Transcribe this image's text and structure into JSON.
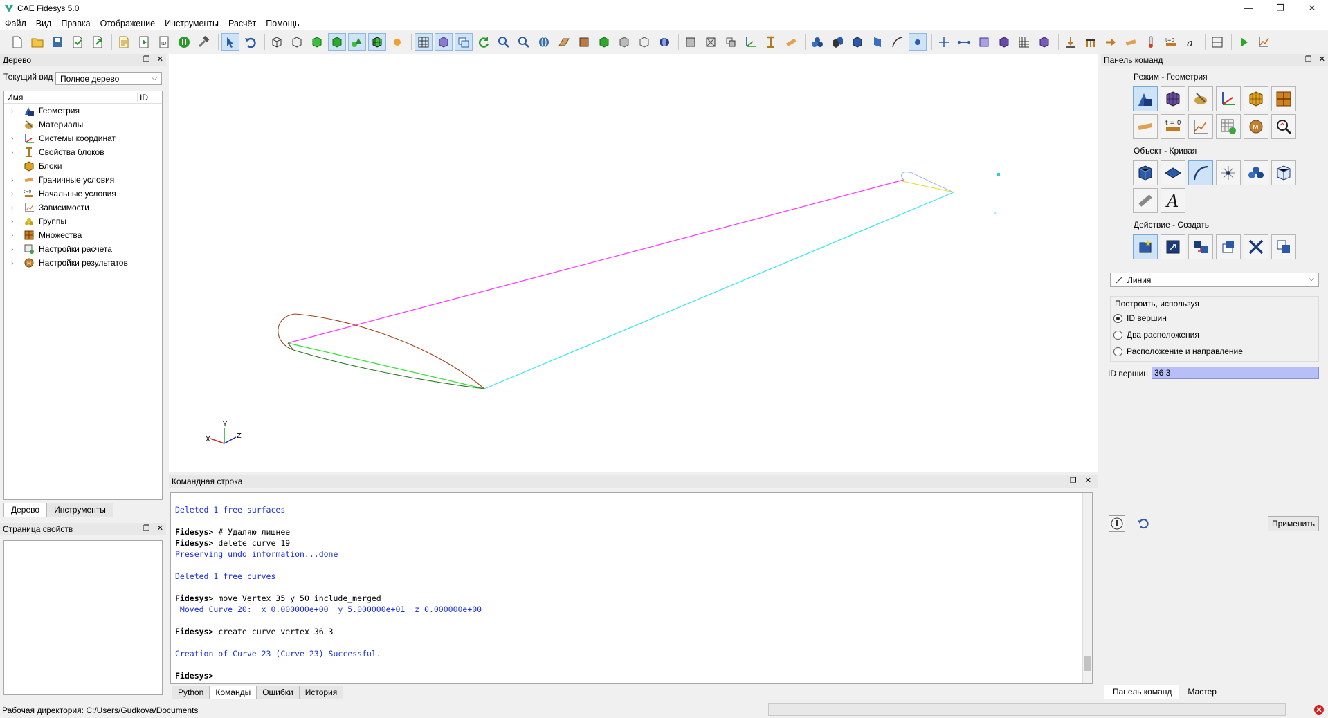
{
  "window": {
    "title": "CAE Fidesys 5.0",
    "controls": [
      "—",
      "❐",
      "✕"
    ]
  },
  "menu": [
    "Файл",
    "Вид",
    "Правка",
    "Отображение",
    "Инструменты",
    "Расчёт",
    "Помощь"
  ],
  "tree_dock": {
    "title": "Дерево",
    "view_label": "Текущий вид",
    "view_value": "Полное дерево",
    "col_name": "Имя",
    "col_id": "ID",
    "items": [
      {
        "label": "Геометрия",
        "icon": "geometry-icon"
      },
      {
        "label": "Материалы",
        "icon": "materials-icon"
      },
      {
        "label": "Системы координат",
        "icon": "coordinate-systems-icon"
      },
      {
        "label": "Свойства блоков",
        "icon": "block-properties-icon"
      },
      {
        "label": "Блоки",
        "icon": "blocks-icon"
      },
      {
        "label": "Граничные условия",
        "icon": "boundary-conditions-icon"
      },
      {
        "label": "Начальные условия",
        "icon": "initial-conditions-icon"
      },
      {
        "label": "Зависимости",
        "icon": "dependencies-icon"
      },
      {
        "label": "Группы",
        "icon": "groups-icon"
      },
      {
        "label": "Множества",
        "icon": "sets-icon"
      },
      {
        "label": "Настройки расчета",
        "icon": "calc-settings-icon"
      },
      {
        "label": "Настройки результатов",
        "icon": "results-settings-icon"
      }
    ],
    "tabs": [
      "Дерево",
      "Инструменты"
    ]
  },
  "props_dock": {
    "title": "Страница свойств"
  },
  "command_dock": {
    "title": "Командная строка",
    "lines": [
      {
        "text": "Deleted 1 free surfaces",
        "style": "blue"
      },
      {
        "text": "",
        "style": "blank"
      },
      {
        "prompt": "Fidesys>",
        "text": " # Удаляю лишнее",
        "style": "prompt"
      },
      {
        "prompt": "Fidesys>",
        "text": " delete curve 19",
        "style": "prompt"
      },
      {
        "text": "Preserving undo information...done",
        "style": "blue"
      },
      {
        "text": "",
        "style": "blank"
      },
      {
        "text": "Deleted 1 free curves",
        "style": "blue"
      },
      {
        "text": "",
        "style": "blank"
      },
      {
        "prompt": "Fidesys>",
        "text": " move Vertex 35 y 50 include_merged",
        "style": "prompt"
      },
      {
        "text": " Moved Curve 20:  x 0.000000e+00  y 5.000000e+01  z 0.000000e+00",
        "style": "blue"
      },
      {
        "text": "",
        "style": "blank"
      },
      {
        "prompt": "Fidesys>",
        "text": " create curve vertex 36 3",
        "style": "prompt"
      },
      {
        "text": "",
        "style": "blank"
      },
      {
        "text": "Creation of Curve 23 (Curve 23) Successful.",
        "style": "blue"
      },
      {
        "text": "",
        "style": "blank"
      },
      {
        "prompt": "Fidesys>",
        "text": "",
        "style": "prompt"
      }
    ],
    "tabs": [
      "Python",
      "Команды",
      "Ошибки",
      "История"
    ],
    "active_tab": 1
  },
  "command_panel": {
    "title": "Панель команд",
    "mode_label": "Режим - Геометрия",
    "object_label": "Объект - Кривая",
    "action_label": "Действие - Создать",
    "type_value": "Линия",
    "build_label": "Построить, используя",
    "options": [
      "ID вершин",
      "Два расположения",
      "Расположение и направление"
    ],
    "selected_option": 0,
    "vertex_id_label": "ID вершин",
    "vertex_id_value": "36 3",
    "apply_label": "Применить",
    "tabs": [
      "Панель команд",
      "Мастер"
    ]
  },
  "axes": {
    "y": "Y",
    "x": "X",
    "z": "Z"
  },
  "status": {
    "workdir": "Рабочая директория: C:/Users/Gudkova/Documents"
  },
  "colors": {
    "magenta": "#ff33ff",
    "cyan": "#33e6f0",
    "green": "#33dd33",
    "brown": "#a0401c",
    "darkgreen": "#2a7a2a",
    "accent": "#cfe3f7"
  }
}
